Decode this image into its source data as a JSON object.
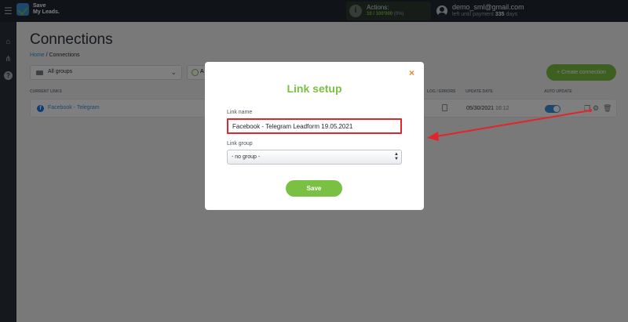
{
  "header": {
    "logo_line1": "Save",
    "logo_line2": "My Leads.",
    "actions_label": "Actions:",
    "actions_count": "10 / 100'000",
    "actions_pct": "(0%)",
    "user_email": "demo_sml@gmail.com",
    "payment_prefix": "left until payment",
    "payment_days": "335",
    "payment_suffix": "days"
  },
  "page": {
    "title": "Connections",
    "breadcrumb_home": "Home",
    "breadcrumb_sep": "/",
    "breadcrumb_current": "Connections",
    "group_filter": "All groups",
    "status_filter_partial": "A",
    "create_button": "+ Create connection"
  },
  "table": {
    "headers": [
      "CURRENT LINKS",
      "LOG / ERRORS",
      "UPDATE DATE",
      "AUTO UPDATE"
    ],
    "rows": [
      {
        "name": "Facebook - Telegram",
        "date": "05/30/2021",
        "time": "16:12",
        "auto_update": true
      }
    ]
  },
  "modal": {
    "title": "Link setup",
    "name_label": "Link name",
    "name_value": "Facebook - Telegram Leadform 19.05.2021",
    "group_label": "Link group",
    "group_value": "- no group -",
    "save_label": "Save",
    "close_glyph": "×"
  },
  "colors": {
    "accent_green": "#7ac143",
    "link_blue": "#3b8fd9",
    "highlight_red": "#e1252c",
    "close_orange": "#f58220"
  },
  "icons": [
    "menu-icon",
    "home-icon",
    "sitemap-icon",
    "help-icon",
    "info-icon",
    "user-icon",
    "folder-icon",
    "play-icon",
    "facebook-icon",
    "log-icon",
    "copy-icon",
    "gear-icon",
    "trash-icon",
    "close-icon",
    "red-arrow-annotation"
  ]
}
